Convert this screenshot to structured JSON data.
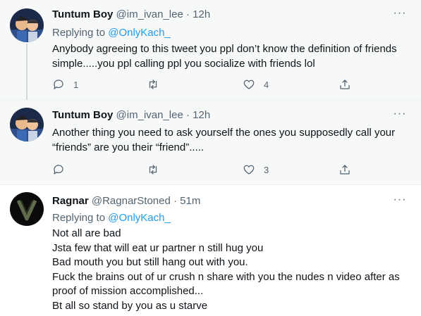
{
  "tweets": [
    {
      "name": "Tuntum Boy",
      "handle": "@im_ivan_lee",
      "dot": "·",
      "time": "12h",
      "replying_prefix": "Replying to ",
      "replying_to": "@OnlyKach_",
      "lines": [
        "Anybody agreeing to this tweet you ppl don’t know the definition of friends",
        "simple.....you ppl calling ppl you socialize with friends lol"
      ],
      "counts": {
        "replies": "1",
        "retweets": "",
        "likes": "4"
      }
    },
    {
      "name": "Tuntum Boy",
      "handle": "@im_ivan_lee",
      "dot": "·",
      "time": "12h",
      "lines": [
        "Another thing you need to ask yourself the ones you supposedly call your",
        "“friends” are you their “friend”....."
      ],
      "counts": {
        "replies": "",
        "retweets": "",
        "likes": "3"
      }
    },
    {
      "name": "Ragnar",
      "handle": "@RagnarStoned",
      "dot": "·",
      "time": "51m",
      "replying_prefix": "Replying to ",
      "replying_to": "@OnlyKach_",
      "lines": [
        "Not all are bad",
        "Jsta few that will eat ur partner n still hug you",
        "Bad mouth you but still hang out with you.",
        "Fuck the brains out of ur crush n share with you the nudes n video after as",
        "proof of mission accomplished...",
        "Bt all so stand by you as u starve"
      ]
    }
  ],
  "icons": {
    "more": "more-horizontal-icon",
    "reply": "speech-bubble-icon",
    "retweet": "retweet-icon",
    "like": "heart-icon",
    "share": "share-icon"
  },
  "colors": {
    "link": "#1d9bf0",
    "secondary_text": "#536471",
    "highlight_bg": "#f7f9f9"
  }
}
